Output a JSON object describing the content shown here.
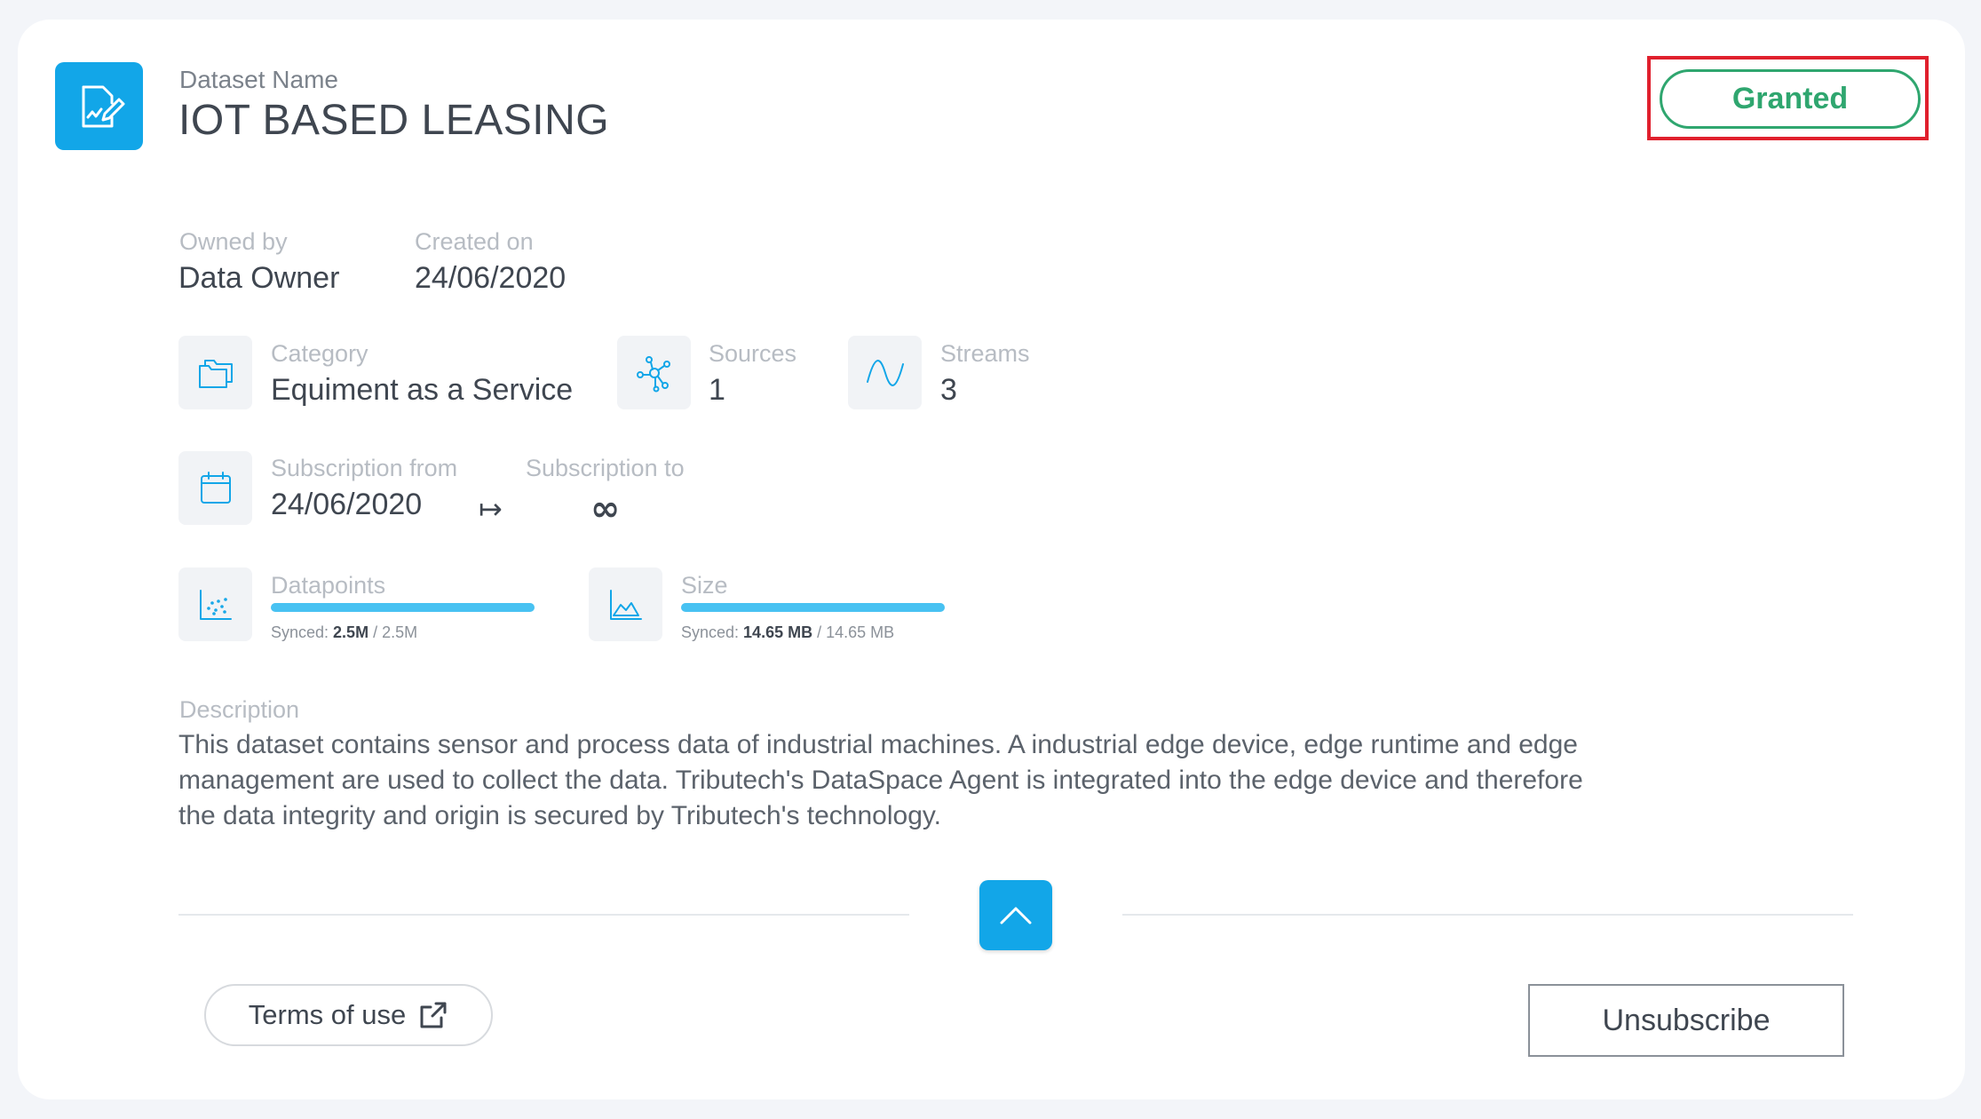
{
  "dataset": {
    "name_label": "Dataset Name",
    "name": "IOT BASED LEASING",
    "status": "Granted"
  },
  "owner": {
    "label": "Owned by",
    "value": "Data Owner"
  },
  "created": {
    "label": "Created on",
    "value": "24/06/2020"
  },
  "category": {
    "label": "Category",
    "value": "Equiment as a Service"
  },
  "sources": {
    "label": "Sources",
    "value": "1"
  },
  "streams": {
    "label": "Streams",
    "value": "3"
  },
  "subscription": {
    "from_label": "Subscription from",
    "from_value": "24/06/2020",
    "arrow": "↦",
    "to_label": "Subscription to",
    "to_value": "∞"
  },
  "datapoints": {
    "label": "Datapoints",
    "synced_prefix": "Synced: ",
    "synced": "2.5M",
    "total": "/ 2.5M",
    "progress": 1.0
  },
  "size": {
    "label": "Size",
    "synced_prefix": "Synced: ",
    "synced": "14.65 MB",
    "total": "/ 14.65 MB",
    "progress": 1.0
  },
  "description": {
    "label": "Description",
    "line1": "This dataset contains sensor and process data of industrial machines. A industrial edge device, edge runtime and edge",
    "line2": "management are used to collect the data. Tributech's DataSpace Agent is integrated into the edge device and therefore",
    "line3": "the data integrity and origin is secured by Tributech's technology."
  },
  "actions": {
    "terms_label": "Terms of use",
    "unsubscribe_label": "Unsubscribe"
  },
  "colors": {
    "accent": "#12a6e8",
    "granted": "#2fa66f",
    "highlight": "#e0202d"
  }
}
